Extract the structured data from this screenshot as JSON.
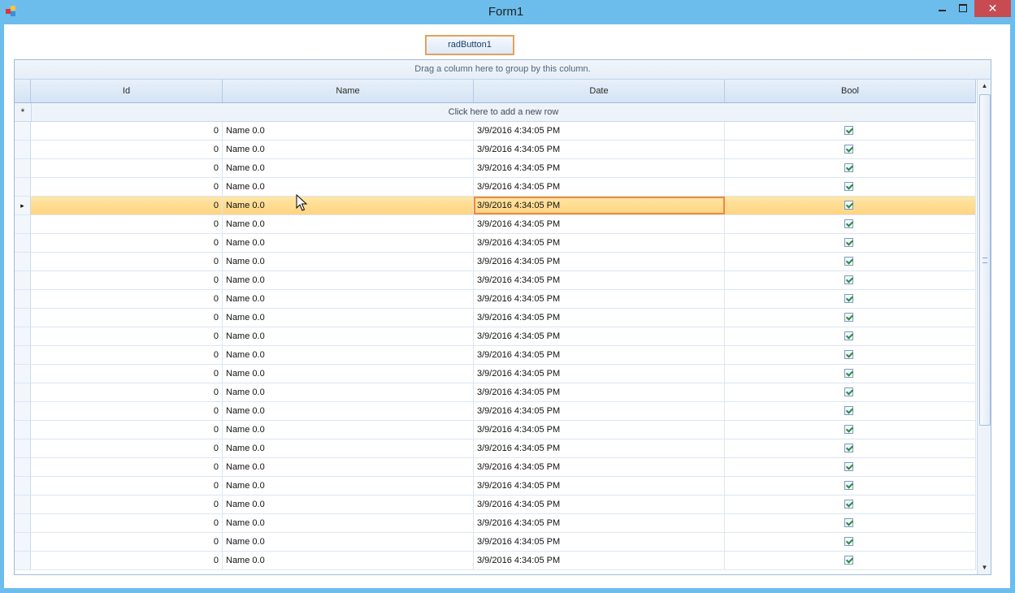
{
  "window": {
    "title": "Form1",
    "minimize_icon": "minimize-icon",
    "maximize_icon": "maximize-icon",
    "close_label": "✕"
  },
  "button": {
    "label": "radButton1"
  },
  "grid": {
    "group_panel_text": "Drag a column here to group by this column.",
    "columns": [
      "Id",
      "Name",
      "Date",
      "Bool"
    ],
    "new_row_text": "Click here to add a new row",
    "new_row_marker": "*",
    "current_row_marker": "▸",
    "current_row_index": 4,
    "rows": [
      {
        "id": "0",
        "name": "Name 0.0",
        "date": "3/9/2016 4:34:05 PM",
        "bool": true
      },
      {
        "id": "0",
        "name": "Name 0.0",
        "date": "3/9/2016 4:34:05 PM",
        "bool": true
      },
      {
        "id": "0",
        "name": "Name 0.0",
        "date": "3/9/2016 4:34:05 PM",
        "bool": true
      },
      {
        "id": "0",
        "name": "Name 0.0",
        "date": "3/9/2016 4:34:05 PM",
        "bool": true
      },
      {
        "id": "0",
        "name": "Name 0.0",
        "date": "3/9/2016 4:34:05 PM",
        "bool": true
      },
      {
        "id": "0",
        "name": "Name 0.0",
        "date": "3/9/2016 4:34:05 PM",
        "bool": true
      },
      {
        "id": "0",
        "name": "Name 0.0",
        "date": "3/9/2016 4:34:05 PM",
        "bool": true
      },
      {
        "id": "0",
        "name": "Name 0.0",
        "date": "3/9/2016 4:34:05 PM",
        "bool": true
      },
      {
        "id": "0",
        "name": "Name 0.0",
        "date": "3/9/2016 4:34:05 PM",
        "bool": true
      },
      {
        "id": "0",
        "name": "Name 0.0",
        "date": "3/9/2016 4:34:05 PM",
        "bool": true
      },
      {
        "id": "0",
        "name": "Name 0.0",
        "date": "3/9/2016 4:34:05 PM",
        "bool": true
      },
      {
        "id": "0",
        "name": "Name 0.0",
        "date": "3/9/2016 4:34:05 PM",
        "bool": true
      },
      {
        "id": "0",
        "name": "Name 0.0",
        "date": "3/9/2016 4:34:05 PM",
        "bool": true
      },
      {
        "id": "0",
        "name": "Name 0.0",
        "date": "3/9/2016 4:34:05 PM",
        "bool": true
      },
      {
        "id": "0",
        "name": "Name 0.0",
        "date": "3/9/2016 4:34:05 PM",
        "bool": true
      },
      {
        "id": "0",
        "name": "Name 0.0",
        "date": "3/9/2016 4:34:05 PM",
        "bool": true
      },
      {
        "id": "0",
        "name": "Name 0.0",
        "date": "3/9/2016 4:34:05 PM",
        "bool": true
      },
      {
        "id": "0",
        "name": "Name 0.0",
        "date": "3/9/2016 4:34:05 PM",
        "bool": true
      },
      {
        "id": "0",
        "name": "Name 0.0",
        "date": "3/9/2016 4:34:05 PM",
        "bool": true
      },
      {
        "id": "0",
        "name": "Name 0.0",
        "date": "3/9/2016 4:34:05 PM",
        "bool": true
      },
      {
        "id": "0",
        "name": "Name 0.0",
        "date": "3/9/2016 4:34:05 PM",
        "bool": true
      },
      {
        "id": "0",
        "name": "Name 0.0",
        "date": "3/9/2016 4:34:05 PM",
        "bool": true
      },
      {
        "id": "0",
        "name": "Name 0.0",
        "date": "3/9/2016 4:34:05 PM",
        "bool": true
      },
      {
        "id": "0",
        "name": "Name 0.0",
        "date": "3/9/2016 4:34:05 PM",
        "bool": true
      }
    ]
  },
  "colors": {
    "title_bar": "#6cbdec",
    "close_button": "#c74b50",
    "selected_row": "#ffd480",
    "focus_border": "#f1883a",
    "checkmark": "#2b8a3e"
  }
}
